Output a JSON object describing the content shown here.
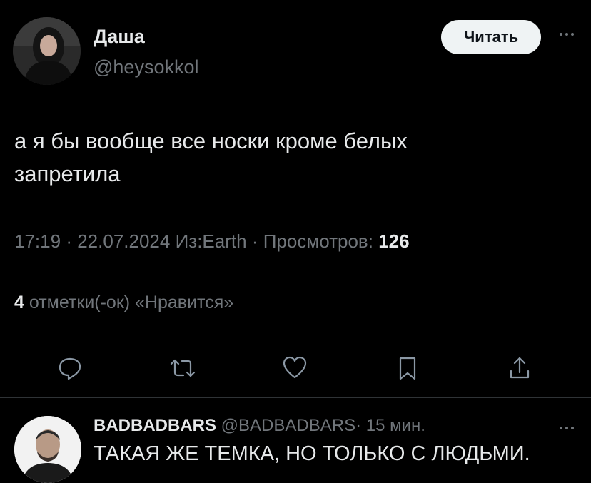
{
  "tweet": {
    "author_name": "Даша",
    "author_handle": "@heysokkol",
    "follow_label": "Читать",
    "text_line1": "а я бы вообще все носки кроме белых",
    "text_line2": "запретила",
    "time": "17:19",
    "date": "22.07.2024",
    "source": "Из:Earth",
    "views_label": "Просмотров:",
    "views_count": "126",
    "likes_count": "4",
    "likes_label": "отметки(-ок) «Нравится»",
    "sep": "·",
    "actions": [
      "reply-icon",
      "retweet-icon",
      "like-icon",
      "bookmark-icon",
      "share-icon"
    ]
  },
  "reply": {
    "author_name": "BADBADBARS",
    "author_handle": "@BADBADBARS",
    "time_ago": "15 мин.",
    "text": "ТАКАЯ ЖЕ ТЕМКА, НО ТОЛЬКО С ЛЮДЬМИ."
  },
  "colors": {
    "background": "#000000",
    "text": "#e7e9ea",
    "secondary": "#71767b",
    "button_bg": "#eff3f4",
    "divider": "#2f3336"
  }
}
